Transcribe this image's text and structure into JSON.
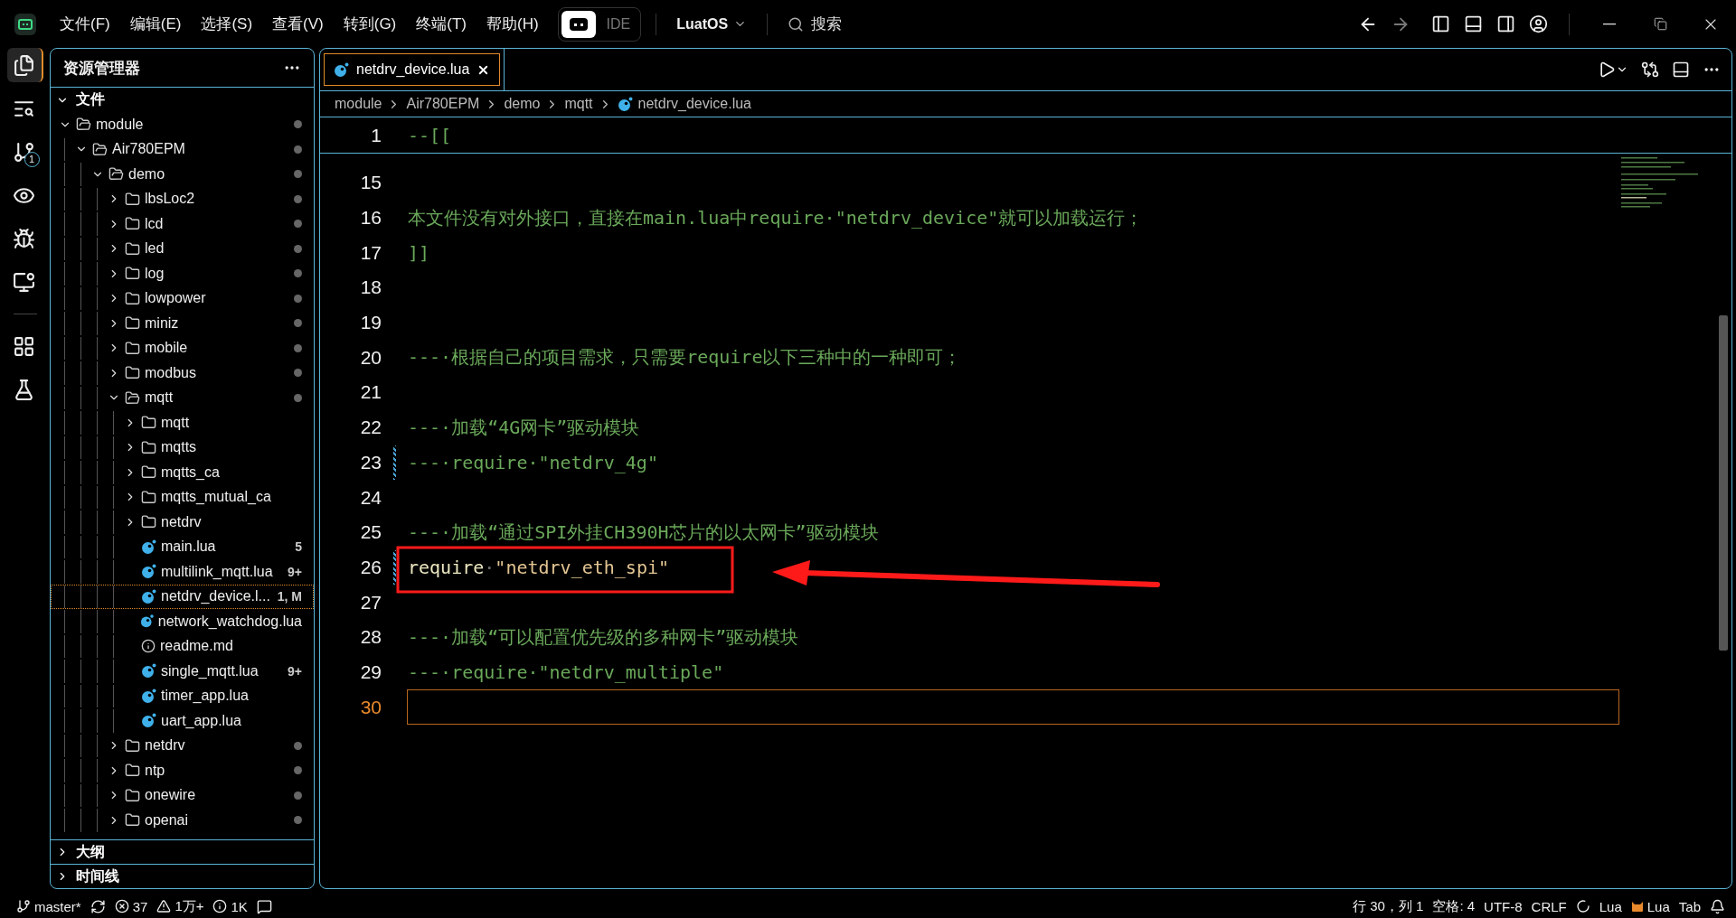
{
  "titlebar": {
    "menus": [
      "文件(F)",
      "编辑(E)",
      "选择(S)",
      "查看(V)",
      "转到(G)",
      "终端(T)",
      "帮助(H)"
    ],
    "mode_options": [
      {
        "kind": "icon",
        "selected": true
      },
      {
        "kind": "text",
        "label": "IDE",
        "selected": false
      }
    ],
    "workspace": "LuatOS",
    "search": {
      "placeholder": "搜索"
    },
    "nav": [
      {
        "kind": "back",
        "disabled": false
      },
      {
        "kind": "forward",
        "disabled": true
      }
    ]
  },
  "activity_bar": [
    {
      "kind": "files",
      "selected": true
    },
    {
      "kind": "search",
      "selected": false
    },
    {
      "kind": "source-control",
      "selected": false,
      "badge": "1"
    },
    {
      "kind": "eye",
      "selected": false
    },
    {
      "kind": "debug",
      "selected": false
    },
    {
      "kind": "remote",
      "selected": false
    },
    {
      "kind": "extensions",
      "selected": false
    },
    {
      "kind": "testing",
      "selected": false
    }
  ],
  "sidebar": {
    "title": "资源管理器",
    "sections": [
      {
        "label": "文件",
        "expanded": true,
        "tree": [
          {
            "name": "module",
            "kind": "folder",
            "expanded": true,
            "selected": false,
            "dot": true,
            "children": [
              {
                "name": "Air780EPM",
                "kind": "folder",
                "expanded": true,
                "selected": false,
                "dot": true,
                "children": [
                  {
                    "name": "demo",
                    "kind": "folder",
                    "expanded": true,
                    "selected": false,
                    "dot": true,
                    "children": [
                      {
                        "name": "lbsLoc2",
                        "kind": "folder",
                        "expanded": false,
                        "selected": false,
                        "dot": true
                      },
                      {
                        "name": "lcd",
                        "kind": "folder",
                        "expanded": false,
                        "selected": false,
                        "dot": true
                      },
                      {
                        "name": "led",
                        "kind": "folder",
                        "expanded": false,
                        "selected": false,
                        "dot": true
                      },
                      {
                        "name": "log",
                        "kind": "folder",
                        "expanded": false,
                        "selected": false,
                        "dot": true
                      },
                      {
                        "name": "lowpower",
                        "kind": "folder",
                        "expanded": false,
                        "selected": false,
                        "dot": true
                      },
                      {
                        "name": "miniz",
                        "kind": "folder",
                        "expanded": false,
                        "selected": false,
                        "dot": true
                      },
                      {
                        "name": "mobile",
                        "kind": "folder",
                        "expanded": false,
                        "selected": false,
                        "dot": true
                      },
                      {
                        "name": "modbus",
                        "kind": "folder",
                        "expanded": false,
                        "selected": false,
                        "dot": true
                      },
                      {
                        "name": "mqtt",
                        "kind": "folder",
                        "expanded": true,
                        "selected": false,
                        "dot": true,
                        "children": [
                          {
                            "name": "mqtt",
                            "kind": "folder",
                            "expanded": false,
                            "selected": false,
                            "dot": false
                          },
                          {
                            "name": "mqtts",
                            "kind": "folder",
                            "expanded": false,
                            "selected": false,
                            "dot": false
                          },
                          {
                            "name": "mqtts_ca",
                            "kind": "folder",
                            "expanded": false,
                            "selected": false,
                            "dot": false
                          },
                          {
                            "name": "mqtts_mutual_ca",
                            "kind": "folder",
                            "expanded": false,
                            "selected": false,
                            "dot": false
                          },
                          {
                            "name": "netdrv",
                            "kind": "folder",
                            "expanded": false,
                            "selected": false,
                            "dot": false
                          },
                          {
                            "name": "main.lua",
                            "kind": "lua",
                            "selected": false,
                            "dot": false,
                            "badge": "5"
                          },
                          {
                            "name": "multilink_mqtt.lua",
                            "kind": "lua",
                            "selected": false,
                            "dot": false,
                            "badge": "9+"
                          },
                          {
                            "name": "netdrv_device.l...",
                            "kind": "lua",
                            "selected": true,
                            "dot": false,
                            "badge": "1, M"
                          },
                          {
                            "name": "network_watchdog.lua",
                            "kind": "lua",
                            "selected": false,
                            "dot": false
                          },
                          {
                            "name": "readme.md",
                            "kind": "info",
                            "selected": false,
                            "dot": false
                          },
                          {
                            "name": "single_mqtt.lua",
                            "kind": "lua",
                            "selected": false,
                            "dot": false,
                            "badge": "9+"
                          },
                          {
                            "name": "timer_app.lua",
                            "kind": "lua",
                            "selected": false,
                            "dot": false
                          },
                          {
                            "name": "uart_app.lua",
                            "kind": "lua",
                            "selected": false,
                            "dot": false
                          }
                        ]
                      },
                      {
                        "name": "netdrv",
                        "kind": "folder",
                        "expanded": false,
                        "selected": false,
                        "dot": true
                      },
                      {
                        "name": "ntp",
                        "kind": "folder",
                        "expanded": false,
                        "selected": false,
                        "dot": true
                      },
                      {
                        "name": "onewire",
                        "kind": "folder",
                        "expanded": false,
                        "selected": false,
                        "dot": true
                      },
                      {
                        "name": "openai",
                        "kind": "folder",
                        "expanded": false,
                        "selected": false,
                        "dot": true
                      }
                    ]
                  }
                ]
              }
            ]
          }
        ]
      },
      {
        "label": "大纲",
        "expanded": false
      },
      {
        "label": "时间线",
        "expanded": false
      }
    ]
  },
  "editor": {
    "tabs": [
      {
        "label": "netdrv_device.lua",
        "selected": true
      }
    ],
    "breadcrumb": [
      "module",
      "Air780EPM",
      "demo",
      "mqtt",
      "netdrv_device.lua"
    ],
    "sticky": {
      "number": "1",
      "tokens": [
        {
          "text": "--[[",
          "kind": "comment"
        }
      ]
    },
    "lines": [
      {
        "number": "15",
        "current": false,
        "modified": false
      },
      {
        "number": "16",
        "current": false,
        "modified": false,
        "tokens": [
          {
            "text": "本文件没有对外接口，直接在main.lua中require·\"netdrv_device\"就可以加载运行；",
            "kind": "comment"
          }
        ]
      },
      {
        "number": "17",
        "current": false,
        "modified": false,
        "tokens": [
          {
            "text": "]]",
            "kind": "comment"
          }
        ]
      },
      {
        "number": "18",
        "current": false,
        "modified": false
      },
      {
        "number": "19",
        "current": false,
        "modified": false
      },
      {
        "number": "20",
        "current": false,
        "modified": false,
        "tokens": [
          {
            "text": "---·根据自己的项目需求，只需要require以下三种中的一种即可；",
            "kind": "comment"
          }
        ]
      },
      {
        "number": "21",
        "current": false,
        "modified": false
      },
      {
        "number": "22",
        "current": false,
        "modified": false,
        "tokens": [
          {
            "text": "---·加载“4G网卡”驱动模块",
            "kind": "comment"
          }
        ]
      },
      {
        "number": "23",
        "current": false,
        "modified": true,
        "tokens": [
          {
            "text": "---·require·\"netdrv_4g\"",
            "kind": "comment"
          }
        ]
      },
      {
        "number": "24",
        "current": false,
        "modified": false
      },
      {
        "number": "25",
        "current": false,
        "modified": false,
        "tokens": [
          {
            "text": "---·加载“通过SPI外挂CH390H芯片的以太网卡”驱动模块",
            "kind": "comment"
          }
        ]
      },
      {
        "number": "26",
        "current": false,
        "modified": true,
        "tokens": [
          {
            "text": "require",
            "kind": "keyword"
          },
          {
            "text": "·",
            "kind": "whitespace"
          },
          {
            "text": "\"netdrv_eth_spi\"",
            "kind": "string"
          }
        ]
      },
      {
        "number": "27",
        "current": false,
        "modified": false
      },
      {
        "number": "28",
        "current": false,
        "modified": false,
        "tokens": [
          {
            "text": "---·加载“可以配置优先级的多种网卡”驱动模块",
            "kind": "comment"
          }
        ]
      },
      {
        "number": "29",
        "current": false,
        "modified": false,
        "tokens": [
          {
            "text": "---·require·\"netdrv_multiple\"",
            "kind": "comment"
          }
        ]
      },
      {
        "number": "30",
        "current": true,
        "modified": false
      }
    ]
  },
  "status_bar": {
    "branch": "master*",
    "errors": "37",
    "warnings": "1万+",
    "infos": "1K",
    "position": "行 30，列 1",
    "indent": "空格: 4",
    "encoding": "UTF-8",
    "eol": "CRLF",
    "language": "Lua",
    "plugin": "Lua",
    "tab_mode": "Tab"
  }
}
